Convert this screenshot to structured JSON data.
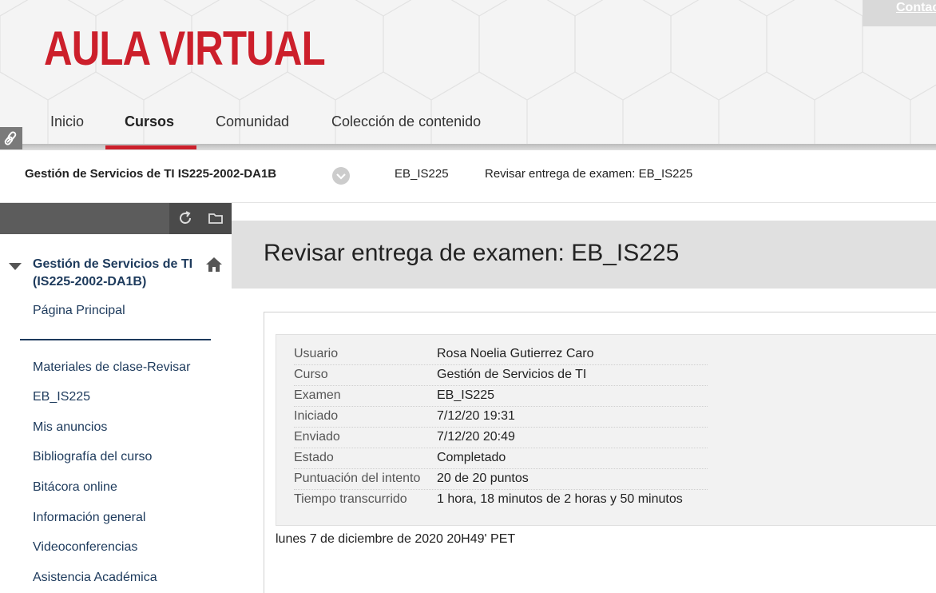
{
  "header": {
    "logo_text": "AULA VIRTUAL",
    "contact_link": "Contac",
    "nav_tabs": [
      {
        "label": "Inicio",
        "active": false
      },
      {
        "label": "Cursos",
        "active": true
      },
      {
        "label": "Comunidad",
        "active": false
      },
      {
        "label": "Colección de contenido",
        "active": false
      }
    ],
    "brand_color": "#cc1f2b"
  },
  "breadcrumb": {
    "course": "Gestión de Servicios de TI IS225-2002-DA1B",
    "item_2": "EB_IS225",
    "item_3": "Revisar entrega de examen: EB_IS225"
  },
  "sidebar": {
    "course_title": "Gestión de Servicios de TI (IS225-2002-DA1B)",
    "items": [
      {
        "label": "Página Principal"
      },
      {
        "label": "Materiales de clase-Revisar"
      },
      {
        "label": "EB_IS225"
      },
      {
        "label": "Mis anuncios"
      },
      {
        "label": "Bibliografía del curso"
      },
      {
        "label": "Bitácora online"
      },
      {
        "label": "Información general"
      },
      {
        "label": "Videoconferencias"
      },
      {
        "label": "Asistencia Académica"
      }
    ]
  },
  "main": {
    "page_title": "Revisar entrega de examen: EB_IS225",
    "summary": [
      {
        "label": "Usuario",
        "value": "Rosa Noelia Gutierrez Caro"
      },
      {
        "label": "Curso",
        "value": "Gestión de Servicios de TI"
      },
      {
        "label": "Examen",
        "value": "EB_IS225"
      },
      {
        "label": "Iniciado",
        "value": "7/12/20 19:31"
      },
      {
        "label": "Enviado",
        "value": "7/12/20 20:49"
      },
      {
        "label": "Estado",
        "value": "Completado"
      },
      {
        "label": "Puntuación del intento",
        "value": "20 de 20 puntos"
      },
      {
        "label": "Tiempo transcurrido",
        "value": "1 hora, 18 minutos de 2 horas y 50 minutos"
      }
    ],
    "timestamp": "lunes 7 de diciembre de 2020 20H49' PET"
  }
}
